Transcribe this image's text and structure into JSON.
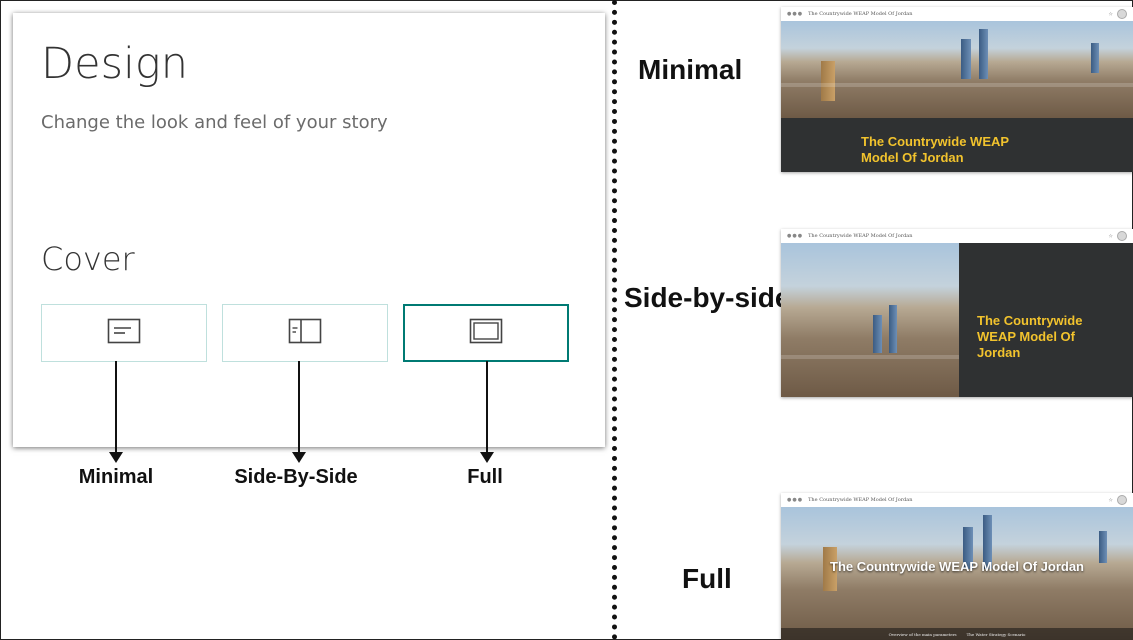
{
  "design_panel": {
    "title": "Design",
    "subtitle": "Change the look and feel of your story",
    "cover_heading": "Cover",
    "options": [
      {
        "icon": "minimal-layout-icon",
        "selected": false,
        "caption": "Minimal"
      },
      {
        "icon": "side-by-side-layout-icon",
        "selected": false,
        "caption": "Side-By-Side"
      },
      {
        "icon": "full-layout-icon",
        "selected": true,
        "caption": "Full"
      }
    ],
    "accent_color": "#007a73",
    "option_border_color": "#bfe0dd"
  },
  "previews": {
    "labels": {
      "minimal": "Minimal",
      "side_by_side": "Side-by-side",
      "full": "Full"
    },
    "story_title": "The Countrywide WEAP Model Of Jordan",
    "topbar_title": "The Countrywide WEAP Model Of Jordan",
    "full_nav": [
      "Overview of the main parameters",
      "The Water Strategy Scenario"
    ],
    "title_color": "#f2c32d",
    "panel_color": "#2f3132"
  }
}
